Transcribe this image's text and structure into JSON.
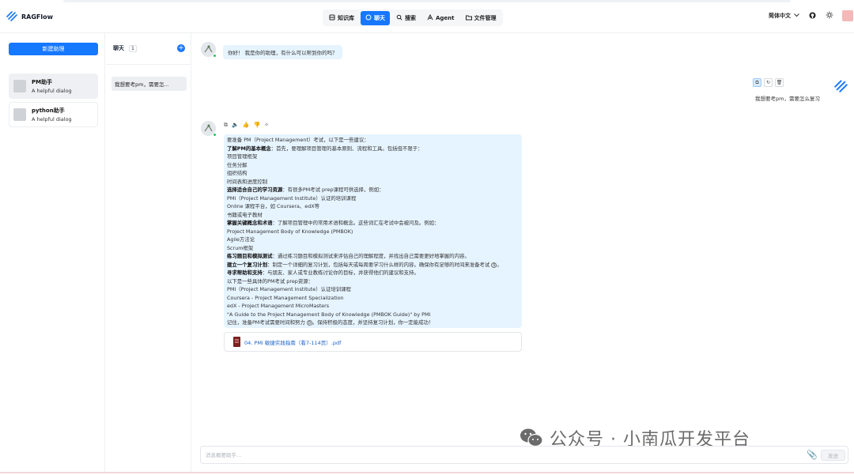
{
  "app": {
    "name": "RAGFlow"
  },
  "nav": [
    {
      "label": "知识库",
      "icon": "database-icon",
      "active": false
    },
    {
      "label": "聊天",
      "icon": "chat-icon",
      "active": true
    },
    {
      "label": "搜索",
      "icon": "search-icon",
      "active": false
    },
    {
      "label": "Agent",
      "icon": "agent-icon",
      "active": false
    },
    {
      "label": "文件管理",
      "icon": "folder-icon",
      "active": false
    }
  ],
  "header": {
    "language": "简体中文"
  },
  "assistants": {
    "new_label": "新建助理",
    "items": [
      {
        "name": "PM助手",
        "desc": "A helpful dialog",
        "active": true
      },
      {
        "name": "python助手",
        "desc": "A helpful dialog",
        "active": false
      }
    ]
  },
  "conversations": {
    "title": "聊天",
    "count": "1",
    "items": [
      {
        "label": "我想要考pm，需要怎..."
      }
    ]
  },
  "chat": {
    "greeting": "你好！ 我是你的助理，有什么可以帮到你的吗？",
    "user_message": "我想要考pm，需要怎么复习",
    "answer_lines": [
      {
        "bold": "",
        "text": "要准备 PM（Project Management）考试，以下是一些建议："
      },
      {
        "bold": "了解PM的基本概念",
        "text": "：首先，要理解项目管理的基本原则、流程和工具。包括但不限于："
      },
      {
        "bold": "",
        "text": "项目管理框架"
      },
      {
        "bold": "",
        "text": "任务分解"
      },
      {
        "bold": "",
        "text": "组织结构"
      },
      {
        "bold": "",
        "text": "时间表和进度控制"
      },
      {
        "bold": "选择适合自己的学习资源",
        "text": "：有很多PM考试 prep课程可供选择，例如："
      },
      {
        "bold": "",
        "text": "PMI（Project Management Institute）认证的培训课程"
      },
      {
        "bold": "",
        "text": "Online 课程平台，如 Coursera、edX等"
      },
      {
        "bold": "",
        "text": "书籍或电子教材"
      },
      {
        "bold": "掌握关键概念和术语",
        "text": "：了解项目管理中的常用术语和概念。这些词汇在考试中会被问及。例如："
      },
      {
        "bold": "",
        "text": "Project Management Body of Knowledge (PMBOK)"
      },
      {
        "bold": "",
        "text": "Agile方法论"
      },
      {
        "bold": "",
        "text": "Scrum框架"
      },
      {
        "bold": "练习题目和模拟测试",
        "text": "：通过练习题目和模拟测试来评估自己的理解程度，并找出自己需要更好地掌握的内容。"
      },
      {
        "bold": "建立一个复习计划",
        "text": "：制定一个详细的复习计划，包括每天或每周要学习什么样的内容。确保你有足够的时间来准备考试",
        "ref": "0",
        "after": "。"
      },
      {
        "bold": "寻求帮助和支持",
        "text": "：与朋友、家人或专业教练讨论你的目标，并获得他们的建议和支持。"
      },
      {
        "bold": "",
        "text": "以下是一些具体的PM考试 prep资源："
      },
      {
        "bold": "",
        "text": "PMI（Project Management Institute）认证培训课程"
      },
      {
        "bold": "",
        "text": "Coursera - Project Management Specialization"
      },
      {
        "bold": "",
        "text": "edX - Project Management MicroMasters"
      },
      {
        "bold": "",
        "text": "\"A Guide to the Project Management Body of Knowledge (PMBOK Guide)\" by PMI"
      },
      {
        "bold": "",
        "text": "记住，准备PM考试需要时间和努力",
        "ref": "0",
        "after": "。保持积极的态度，并坚持复习计划，你一定能成功！"
      }
    ],
    "file_name": "04. PMI 敏捷实践指南（看7-114页）.pdf",
    "input_placeholder": "消息概要助手...",
    "send_label": "发送"
  },
  "watermark": {
    "text": "公众号 · 小南瓜开发平台"
  },
  "colors": {
    "accent": "#1677ff",
    "bubble": "#e6f4ff"
  }
}
